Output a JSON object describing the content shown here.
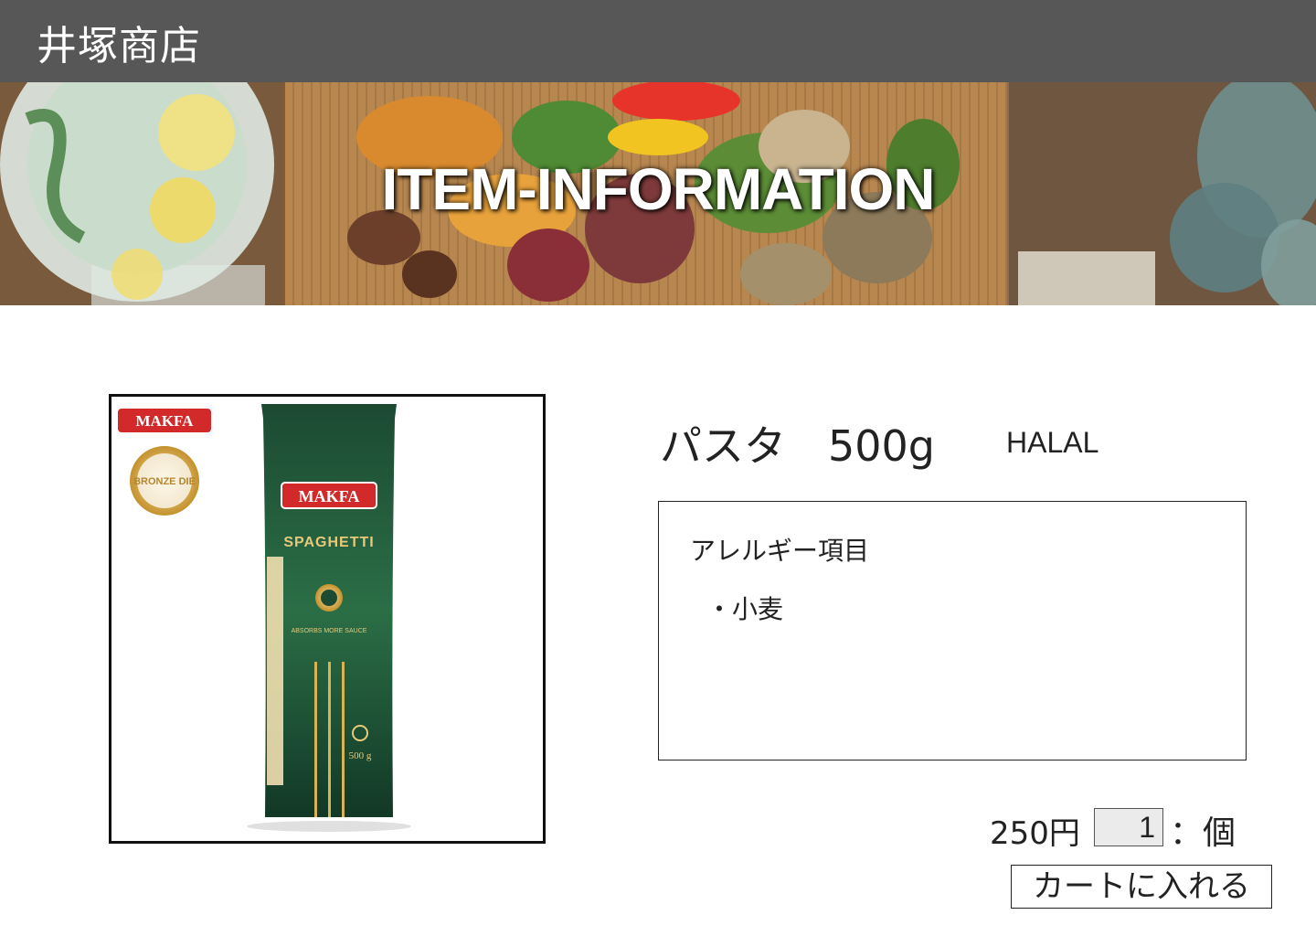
{
  "header": {
    "shop_name": "井塚商店",
    "background_color": "#575757"
  },
  "banner": {
    "title": "ITEM-INFORMATION",
    "image_description": "wooden board with grilled meats, vegetables, lemon water pitcher and eucalyptus leaves"
  },
  "product": {
    "image": {
      "brand_logo": "MAKFA",
      "badge": "BRONZE DIE",
      "package_brand": "MAKFA",
      "package_label": "SPAGHETTI",
      "package_sublabel": "ABSORBS MORE SAUCE",
      "package_weight": "500 g"
    },
    "name": "パスタ　500g",
    "tag": "HALAL"
  },
  "allergy": {
    "title": "アレルギー項目",
    "items": [
      "・小麦"
    ]
  },
  "purchase": {
    "price": "250円",
    "quantity": "1",
    "unit": "：個",
    "cart_button_label": "カートに入れる"
  }
}
